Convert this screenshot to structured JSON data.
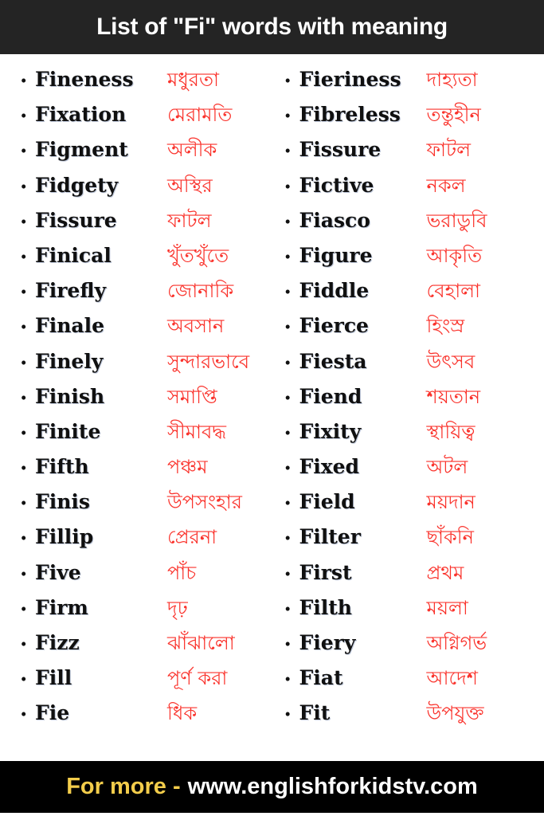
{
  "header": {
    "title": "List of \"Fi\" words with meaning",
    "background_color": "#242424",
    "text_color": "#ffffff"
  },
  "colors": {
    "page_background": "#ffffff",
    "english_word": "#101010",
    "bengali_meaning": "#fa332c",
    "footer_background": "#000000",
    "footer_label": "#f3cd4b",
    "footer_url": "#ffffff"
  },
  "bullet": {
    "glyph": "•",
    "icon_name": "bullet-point-icon"
  },
  "columns": {
    "left": [
      {
        "word": "Fineness",
        "meaning": "মধুরতা"
      },
      {
        "word": "Fixation",
        "meaning": "মেরামতি"
      },
      {
        "word": "Figment",
        "meaning": "অলীক"
      },
      {
        "word": "Fidgety",
        "meaning": "অস্থির"
      },
      {
        "word": "Fissure",
        "meaning": "ফাটল"
      },
      {
        "word": "Finical",
        "meaning": "খুঁতখুঁতে"
      },
      {
        "word": "Firefly",
        "meaning": "জোনাকি"
      },
      {
        "word": "Finale",
        "meaning": "অবসান"
      },
      {
        "word": "Finely",
        "meaning": "সুন্দারভাবে"
      },
      {
        "word": "Finish",
        "meaning": "সমাপ্তি"
      },
      {
        "word": "Finite",
        "meaning": "সীমাবদ্ধ"
      },
      {
        "word": "Fifth",
        "meaning": "পঞ্চম"
      },
      {
        "word": "Finis",
        "meaning": "উপসংহার"
      },
      {
        "word": "Fillip",
        "meaning": "প্রেরনা"
      },
      {
        "word": "Five",
        "meaning": "পাঁচ"
      },
      {
        "word": "Firm",
        "meaning": "দৃঢ়"
      },
      {
        "word": "Fizz",
        "meaning": "ঝাঁঝালো"
      },
      {
        "word": "Fill",
        "meaning": "পূর্ণ করা"
      },
      {
        "word": "Fie",
        "meaning": "ধিক"
      }
    ],
    "right": [
      {
        "word": "Fieriness",
        "meaning": "দাহ্যতা"
      },
      {
        "word": "Fibreless",
        "meaning": "তন্তুহীন"
      },
      {
        "word": "Fissure",
        "meaning": "ফাটল"
      },
      {
        "word": "Fictive",
        "meaning": "নকল"
      },
      {
        "word": "Fiasco",
        "meaning": "ভরাডুবি"
      },
      {
        "word": "Figure",
        "meaning": "আকৃতি"
      },
      {
        "word": "Fiddle",
        "meaning": "বেহালা"
      },
      {
        "word": "Fierce",
        "meaning": "হিংস্র"
      },
      {
        "word": "Fiesta",
        "meaning": "উৎসব"
      },
      {
        "word": "Fiend",
        "meaning": "শয়তান"
      },
      {
        "word": "Fixity",
        "meaning": "স্থায়িত্ব"
      },
      {
        "word": "Fixed",
        "meaning": "অটল"
      },
      {
        "word": "Field",
        "meaning": "ময়দান"
      },
      {
        "word": "Filter",
        "meaning": "ছাঁকনি"
      },
      {
        "word": "First",
        "meaning": "প্রথম"
      },
      {
        "word": "Filth",
        "meaning": "ময়লা"
      },
      {
        "word": "Fiery",
        "meaning": "অগ্নিগর্ভ"
      },
      {
        "word": "Fiat",
        "meaning": "আদেশ"
      },
      {
        "word": "Fit",
        "meaning": "উপযুক্ত"
      }
    ]
  },
  "footer": {
    "label": "For more -",
    "url": "www.englishforkidstv.com"
  }
}
